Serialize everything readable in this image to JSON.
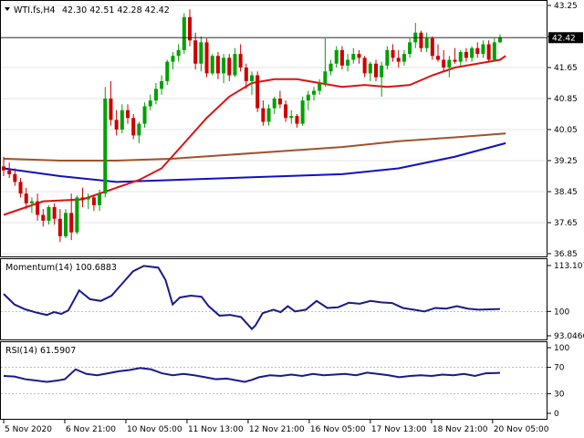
{
  "chart_data": [
    {
      "type": "candlestick",
      "panel": "price",
      "title": "WTI.fs,H4",
      "ohlc_label": "42.30 42.51 42.28 42.42",
      "current_price": "42.42",
      "y_ticks": [
        "43.25",
        "42.45",
        "41.65",
        "40.85",
        "40.05",
        "39.25",
        "38.45",
        "37.65",
        "36.85"
      ],
      "ylim": [
        36.85,
        43.25
      ],
      "x_labels": [
        "5 Nov 2020",
        "6 Nov 21:00",
        "10 Nov 05:00",
        "11 Nov 13:00",
        "12 Nov 21:00",
        "16 Nov 05:00",
        "17 Nov 13:00",
        "18 Nov 21:00",
        "20 Nov 05:00"
      ],
      "colors": {
        "up": "#00a000",
        "down": "#cc0000",
        "ma_fast": "#dd1111",
        "ma_mid": "#a0522d",
        "ma_slow": "#1010c0",
        "grid": "#c8c8c8"
      },
      "candles": [
        [
          39.1,
          39.35,
          38.85,
          39.0
        ],
        [
          39.0,
          39.2,
          38.8,
          38.9
        ],
        [
          38.9,
          39.05,
          38.6,
          38.7
        ],
        [
          38.7,
          38.8,
          38.3,
          38.4
        ],
        [
          38.4,
          38.55,
          38.0,
          38.15
        ],
        [
          38.15,
          38.3,
          37.9,
          38.2
        ],
        [
          38.2,
          38.4,
          37.7,
          37.85
        ],
        [
          37.85,
          38.0,
          37.55,
          37.7
        ],
        [
          37.7,
          38.1,
          37.6,
          38.05
        ],
        [
          38.05,
          38.15,
          37.6,
          37.75
        ],
        [
          37.75,
          38.0,
          37.15,
          37.3
        ],
        [
          37.3,
          38.0,
          37.25,
          37.9
        ],
        [
          37.9,
          38.4,
          37.2,
          37.4
        ],
        [
          37.4,
          38.35,
          37.35,
          38.3
        ],
        [
          38.3,
          38.55,
          38.05,
          38.25
        ],
        [
          38.25,
          38.4,
          38.0,
          38.3
        ],
        [
          38.3,
          38.35,
          37.95,
          38.1
        ],
        [
          38.1,
          38.5,
          37.95,
          38.4
        ],
        [
          38.4,
          41.15,
          38.3,
          40.85
        ],
        [
          40.85,
          41.3,
          40.15,
          40.3
        ],
        [
          40.3,
          40.55,
          39.9,
          40.05
        ],
        [
          40.05,
          40.7,
          39.95,
          40.55
        ],
        [
          40.55,
          40.7,
          40.2,
          40.35
        ],
        [
          40.35,
          40.45,
          39.8,
          39.9
        ],
        [
          39.9,
          40.25,
          39.7,
          40.2
        ],
        [
          40.2,
          40.75,
          40.1,
          40.65
        ],
        [
          40.65,
          40.95,
          40.55,
          40.8
        ],
        [
          40.8,
          41.25,
          40.7,
          41.1
        ],
        [
          41.1,
          41.45,
          40.95,
          41.3
        ],
        [
          41.3,
          41.85,
          41.2,
          41.8
        ],
        [
          41.8,
          42.05,
          41.6,
          41.95
        ],
        [
          41.95,
          42.25,
          41.8,
          42.1
        ],
        [
          42.1,
          43.05,
          42.0,
          42.95
        ],
        [
          42.95,
          43.15,
          42.2,
          42.35
        ],
        [
          42.35,
          42.55,
          41.6,
          41.75
        ],
        [
          41.75,
          42.45,
          41.55,
          42.3
        ],
        [
          42.3,
          42.4,
          41.4,
          41.5
        ],
        [
          41.5,
          42.0,
          41.45,
          41.95
        ],
        [
          41.95,
          42.05,
          41.35,
          41.5
        ],
        [
          41.5,
          42.0,
          41.25,
          41.9
        ],
        [
          41.9,
          42.0,
          41.3,
          41.45
        ],
        [
          41.45,
          42.15,
          41.4,
          42.0
        ],
        [
          42.0,
          42.25,
          41.55,
          41.65
        ],
        [
          41.65,
          41.75,
          41.1,
          41.3
        ],
        [
          41.3,
          41.55,
          40.95,
          41.45
        ],
        [
          41.45,
          41.55,
          40.5,
          40.6
        ],
        [
          40.6,
          40.8,
          40.15,
          40.25
        ],
        [
          40.25,
          40.7,
          40.15,
          40.6
        ],
        [
          40.6,
          40.9,
          40.45,
          40.85
        ],
        [
          40.85,
          41.05,
          40.6,
          40.7
        ],
        [
          40.7,
          40.8,
          40.25,
          40.35
        ],
        [
          40.35,
          40.55,
          40.2,
          40.4
        ],
        [
          40.4,
          40.45,
          40.1,
          40.2
        ],
        [
          40.2,
          40.9,
          40.15,
          40.8
        ],
        [
          40.8,
          41.05,
          40.55,
          40.95
        ],
        [
          40.95,
          41.15,
          40.8,
          41.05
        ],
        [
          41.05,
          41.35,
          40.95,
          41.25
        ],
        [
          41.25,
          42.4,
          41.15,
          41.55
        ],
        [
          41.55,
          41.85,
          41.45,
          41.75
        ],
        [
          41.75,
          42.2,
          41.65,
          42.1
        ],
        [
          42.1,
          42.2,
          41.6,
          41.7
        ],
        [
          41.7,
          42.0,
          41.55,
          41.85
        ],
        [
          41.85,
          42.15,
          41.75,
          42.0
        ],
        [
          42.0,
          42.1,
          41.75,
          41.9
        ],
        [
          41.9,
          41.95,
          41.4,
          41.5
        ],
        [
          41.5,
          41.8,
          41.3,
          41.75
        ],
        [
          41.75,
          41.85,
          41.3,
          41.4
        ],
        [
          41.4,
          41.8,
          40.9,
          41.7
        ],
        [
          41.7,
          42.2,
          41.6,
          42.1
        ],
        [
          42.1,
          42.25,
          41.8,
          41.9
        ],
        [
          41.9,
          42.1,
          41.65,
          41.8
        ],
        [
          41.8,
          42.1,
          41.7,
          42.0
        ],
        [
          42.0,
          42.4,
          41.9,
          42.3
        ],
        [
          42.3,
          42.8,
          42.15,
          42.55
        ],
        [
          42.55,
          42.6,
          42.05,
          42.15
        ],
        [
          42.15,
          42.55,
          42.05,
          42.4
        ],
        [
          42.4,
          42.45,
          41.85,
          41.95
        ],
        [
          41.95,
          42.25,
          41.8,
          41.85
        ],
        [
          41.85,
          42.1,
          41.55,
          41.65
        ],
        [
          41.65,
          41.95,
          41.4,
          41.85
        ],
        [
          41.85,
          42.15,
          41.75,
          41.8
        ],
        [
          41.8,
          42.1,
          41.7,
          42.05
        ],
        [
          42.05,
          42.15,
          41.8,
          41.9
        ],
        [
          41.9,
          42.2,
          41.8,
          42.15
        ],
        [
          42.15,
          42.3,
          41.9,
          42.0
        ],
        [
          42.0,
          42.35,
          41.9,
          42.25
        ],
        [
          42.25,
          42.35,
          41.8,
          41.85
        ],
        [
          41.85,
          42.4,
          41.8,
          42.3
        ],
        [
          42.3,
          42.51,
          42.28,
          42.42
        ]
      ],
      "ma_fast": [
        [
          0,
          37.85
        ],
        [
          7,
          38.2
        ],
        [
          14,
          38.25
        ],
        [
          18,
          38.45
        ],
        [
          24,
          38.75
        ],
        [
          28,
          39.05
        ],
        [
          32,
          39.7
        ],
        [
          36,
          40.35
        ],
        [
          40,
          40.9
        ],
        [
          44,
          41.25
        ],
        [
          48,
          41.35
        ],
        [
          52,
          41.35
        ],
        [
          56,
          41.25
        ],
        [
          60,
          41.15
        ],
        [
          64,
          41.2
        ],
        [
          68,
          41.15
        ],
        [
          72,
          41.2
        ],
        [
          76,
          41.45
        ],
        [
          80,
          41.65
        ],
        [
          84,
          41.75
        ],
        [
          88,
          41.85
        ],
        [
          89,
          41.95
        ]
      ],
      "ma_mid": [
        [
          0,
          39.3
        ],
        [
          10,
          39.25
        ],
        [
          20,
          39.25
        ],
        [
          30,
          39.3
        ],
        [
          40,
          39.4
        ],
        [
          50,
          39.5
        ],
        [
          60,
          39.6
        ],
        [
          70,
          39.75
        ],
        [
          80,
          39.85
        ],
        [
          89,
          39.95
        ]
      ],
      "ma_slow": [
        [
          0,
          39.05
        ],
        [
          10,
          38.85
        ],
        [
          20,
          38.7
        ],
        [
          30,
          38.75
        ],
        [
          40,
          38.8
        ],
        [
          50,
          38.85
        ],
        [
          60,
          38.9
        ],
        [
          70,
          39.05
        ],
        [
          80,
          39.35
        ],
        [
          89,
          39.7
        ]
      ]
    },
    {
      "type": "line",
      "panel": "momentum",
      "title": "Momentum(14) 100.6883",
      "y_ticks": [
        "113.1076",
        "100",
        "93.0466"
      ],
      "ylim": [
        93.0466,
        113.1076
      ],
      "color": "#1a1a8a",
      "values": [
        [
          0,
          105.0
        ],
        [
          3,
          102.0
        ],
        [
          6,
          100.6
        ],
        [
          9,
          99.7
        ],
        [
          12,
          99.0
        ],
        [
          14,
          99.8
        ],
        [
          16,
          99.3
        ],
        [
          18,
          100.3
        ],
        [
          21,
          106.0
        ],
        [
          24,
          103.5
        ],
        [
          27,
          103.0
        ],
        [
          30,
          104.5
        ],
        [
          33,
          108.0
        ],
        [
          36,
          111.5
        ],
        [
          39,
          113.0
        ],
        [
          43,
          112.5
        ],
        [
          45,
          109.0
        ],
        [
          47,
          102.0
        ],
        [
          49,
          104.0
        ],
        [
          52,
          104.5
        ],
        [
          55,
          104.2
        ],
        [
          57,
          101.5
        ],
        [
          60,
          98.8
        ],
        [
          63,
          99.0
        ],
        [
          66,
          98.4
        ],
        [
          69,
          95.0
        ],
        [
          70,
          96.0
        ],
        [
          72,
          99.5
        ],
        [
          75,
          100.5
        ],
        [
          77,
          99.8
        ],
        [
          79,
          101.5
        ],
        [
          81,
          100.0
        ],
        [
          84,
          100.5
        ],
        [
          87,
          103.0
        ],
        [
          90,
          101.0
        ],
        [
          93,
          101.2
        ],
        [
          96,
          102.5
        ],
        [
          99,
          102.2
        ],
        [
          102,
          103.0
        ],
        [
          105,
          102.6
        ],
        [
          108,
          102.4
        ],
        [
          111,
          101.0
        ],
        [
          114,
          100.5
        ],
        [
          117,
          100.0
        ],
        [
          120,
          101.0
        ],
        [
          123,
          100.8
        ],
        [
          126,
          101.5
        ],
        [
          129,
          100.8
        ],
        [
          132,
          100.5
        ],
        [
          135,
          100.6
        ],
        [
          138,
          100.6883
        ]
      ]
    },
    {
      "type": "line",
      "panel": "rsi",
      "title": "RSI(14) 61.5907",
      "y_ticks": [
        "100",
        "70",
        "30",
        "0"
      ],
      "ylim": [
        0,
        100
      ],
      "levels": [
        70,
        30
      ],
      "color": "#1a1a8a",
      "values": [
        [
          0,
          57.0
        ],
        [
          3,
          56.0
        ],
        [
          6,
          52.0
        ],
        [
          9,
          50.0
        ],
        [
          12,
          48.0
        ],
        [
          15,
          50.0
        ],
        [
          17,
          52.0
        ],
        [
          20,
          67.0
        ],
        [
          23,
          60.0
        ],
        [
          26,
          58.0
        ],
        [
          29,
          61.0
        ],
        [
          32,
          64.0
        ],
        [
          35,
          66.0
        ],
        [
          38,
          69.0
        ],
        [
          41,
          67.0
        ],
        [
          44,
          61.0
        ],
        [
          47,
          58.0
        ],
        [
          50,
          60.0
        ],
        [
          53,
          58.0
        ],
        [
          56,
          55.0
        ],
        [
          59,
          52.0
        ],
        [
          62,
          53.0
        ],
        [
          65,
          50.0
        ],
        [
          67,
          48.0
        ],
        [
          69,
          51.0
        ],
        [
          71,
          55.0
        ],
        [
          74,
          58.0
        ],
        [
          77,
          57.0
        ],
        [
          80,
          59.0
        ],
        [
          83,
          57.0
        ],
        [
          86,
          60.0
        ],
        [
          89,
          58.0
        ],
        [
          92,
          59.0
        ],
        [
          95,
          60.0
        ],
        [
          98,
          58.0
        ],
        [
          101,
          62.0
        ],
        [
          104,
          60.0
        ],
        [
          107,
          58.0
        ],
        [
          110,
          55.0
        ],
        [
          113,
          57.0
        ],
        [
          116,
          58.0
        ],
        [
          119,
          57.0
        ],
        [
          122,
          59.0
        ],
        [
          125,
          58.0
        ],
        [
          128,
          60.0
        ],
        [
          131,
          57.0
        ],
        [
          134,
          61.0
        ],
        [
          138,
          61.5907
        ]
      ]
    }
  ]
}
